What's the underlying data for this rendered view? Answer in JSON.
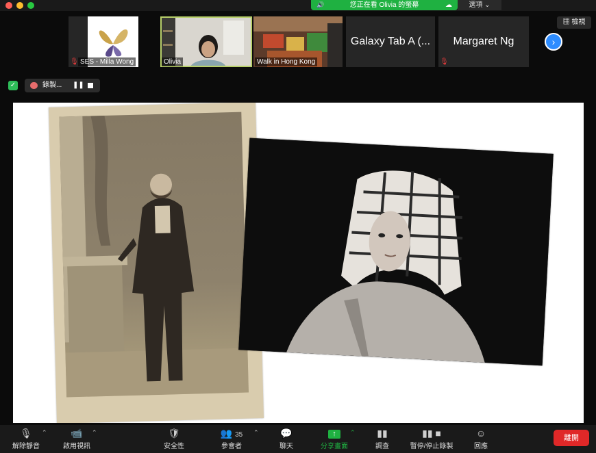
{
  "window": {
    "viewing_text": "您正在看 Olivia 的螢幕",
    "options_label": "選項 ⌄"
  },
  "thumbnails": [
    {
      "name": "SES - Milla Wong",
      "muted": true
    },
    {
      "name": "Olivia",
      "muted": false,
      "active": true
    },
    {
      "name": "Walk in Hong Kong",
      "muted": false
    },
    {
      "name": "Galaxy Tab A (...",
      "muted": false
    },
    {
      "name": "Margaret Ng",
      "muted": true
    }
  ],
  "view_label": "檢視",
  "recording": {
    "label": "錄製...",
    "pause_icon": "❚❚"
  },
  "toolbar": {
    "unmute": "解除靜音",
    "start_video": "啟用視訊",
    "security": "安全性",
    "participants": "參會者",
    "participants_count": "35",
    "chat": "聊天",
    "share_screen": "分享畫面",
    "polls": "調查",
    "pause_stop_recording": "暫停/停止錄製",
    "reactions": "回應",
    "leave": "離開"
  },
  "colors": {
    "share_green": "#1fb141",
    "leave_red": "#e02828",
    "accent_blue": "#2d8cff"
  }
}
